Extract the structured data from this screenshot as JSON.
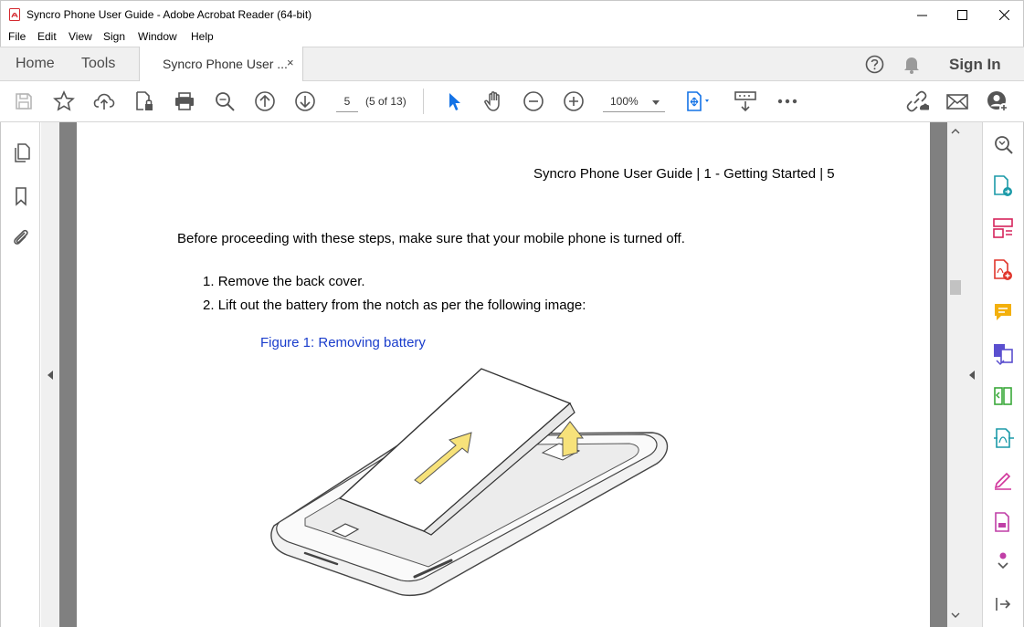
{
  "window": {
    "title": "Syncro Phone User Guide - Adobe Acrobat Reader (64-bit)"
  },
  "menu": {
    "items": [
      "File",
      "Edit",
      "View",
      "Sign",
      "Window",
      "Help"
    ]
  },
  "tabs": {
    "home": "Home",
    "tools": "Tools",
    "document": "Syncro Phone User ...",
    "close": "×",
    "sign_in": "Sign In"
  },
  "toolbar": {
    "page_number": "5",
    "page_count": "(5 of 13)",
    "zoom": "100%",
    "icons": [
      "save-icon",
      "bookmark-star-icon",
      "upload-icon",
      "protect-icon",
      "print-icon",
      "find-icon",
      "prev-page-icon",
      "next-page-icon",
      "select-icon",
      "hand-icon",
      "zoom-out-icon",
      "zoom-in-icon",
      "fit-page-icon",
      "read-mode-icon",
      "more-icon",
      "share-link-icon",
      "email-icon",
      "add-user-icon"
    ]
  },
  "document": {
    "header": "Syncro Phone User Guide | 1 - Getting Started | 5",
    "intro": "Before proceeding with these steps, make sure that your mobile phone is turned off.",
    "steps": [
      {
        "num": "1.",
        "text": "Remove the back cover."
      },
      {
        "num": "2.",
        "text": "Lift out the battery from the notch as per the following image:"
      }
    ],
    "figure_caption": "Figure 1: Removing battery"
  },
  "colors": {
    "accent_blue": "#1473e6",
    "caption_blue": "#1a3dcc",
    "doc_background": "#808080",
    "arrow_yellow": "#f7e27a"
  }
}
